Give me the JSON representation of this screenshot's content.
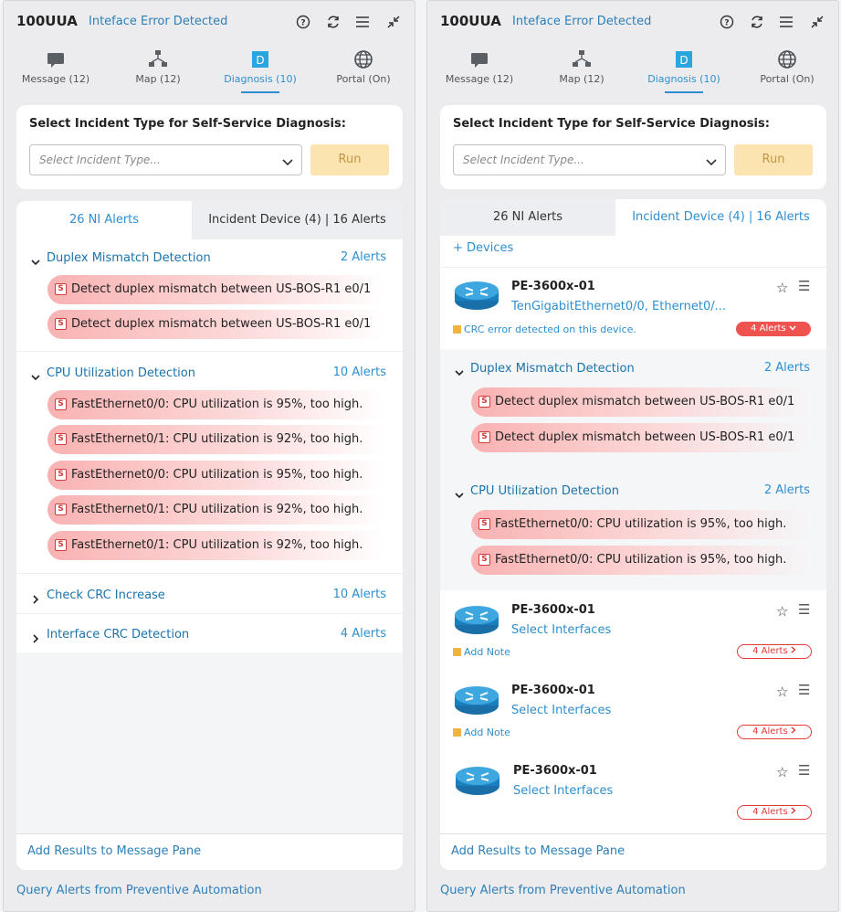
{
  "app_title": "100UUA",
  "error_title": "Inteface Error Detected",
  "tabs": [
    {
      "label": "Message (12)",
      "icon": "message-icon"
    },
    {
      "label": "Map (12)",
      "icon": "map-icon"
    },
    {
      "label": "Diagnosis (10)",
      "icon": "diagnosis-icon"
    },
    {
      "label": "Portal (On)",
      "icon": "globe-icon"
    }
  ],
  "diag_icon_letter": "D",
  "select_title": "Select Incident Type for Self-Service Diagnosis:",
  "select_placeholder": "Select Incident Type...",
  "run_label": "Run",
  "alert_tab_ni": "26 NI Alerts",
  "alert_tab_device": "Incident Device (4) | 16 Alerts",
  "alert_badge": "S",
  "left": {
    "groups": [
      {
        "name": "Duplex Mismatch Detection",
        "count": "2 Alerts",
        "alerts": [
          "Detect duplex mismatch between US-BOS-R1 e0/1",
          "Detect duplex mismatch between US-BOS-R1 e0/1"
        ]
      },
      {
        "name": "CPU Utilization Detection",
        "count": "10 Alerts",
        "alerts": [
          "FastEthernet0/0: CPU utilization is 95%, too high.",
          "FastEthernet0/1: CPU utilization is 92%, too high.",
          "FastEthernet0/0: CPU utilization is 95%, too high.",
          "FastEthernet0/1: CPU utilization is 92%, too high.",
          "FastEthernet0/1: CPU utilization is 92%, too high."
        ]
      },
      {
        "name": "Check CRC Increase",
        "count": "10 Alerts",
        "alerts": []
      },
      {
        "name": "Interface CRC Detection",
        "count": "4 Alerts",
        "alerts": []
      }
    ]
  },
  "right": {
    "add_devices": "+ Devices",
    "devices": [
      {
        "name": "PE-3600x-01",
        "sub": "TenGigabitEthernet0/0, Ethernet0/...",
        "note": "CRC error detected on this device.",
        "alerts": "4 Alerts",
        "groups": [
          {
            "name": "Duplex Mismatch Detection",
            "count": "2 Alerts",
            "alerts": [
              "Detect duplex mismatch between US-BOS-R1 e0/1",
              "Detect duplex mismatch between US-BOS-R1 e0/1"
            ]
          },
          {
            "name": "CPU Utilization Detection",
            "count": "2 Alerts",
            "alerts": [
              "FastEthernet0/0: CPU utilization is 95%, too high.",
              "FastEthernet0/0: CPU utilization is 95%, too high."
            ]
          }
        ]
      },
      {
        "name": "PE-3600x-01",
        "sub": "Select Interfaces",
        "note": "Add Note",
        "alerts": "4 Alerts"
      },
      {
        "name": "PE-3600x-01",
        "sub": "Select Interfaces",
        "note": "Add Note",
        "alerts": "4 Alerts"
      },
      {
        "name": "PE-3600x-01",
        "sub": "Select Interfaces",
        "note": "",
        "alerts": "4 Alerts"
      }
    ]
  },
  "add_results": "Add Results to Message Pane",
  "query_alerts": "Query Alerts from Preventive Automation",
  "colors": {
    "accent": "#2d8fd0",
    "alert_red": "#ef5350",
    "run_bg": "#fbe4b0",
    "diag_icon": "#2aa6de"
  }
}
